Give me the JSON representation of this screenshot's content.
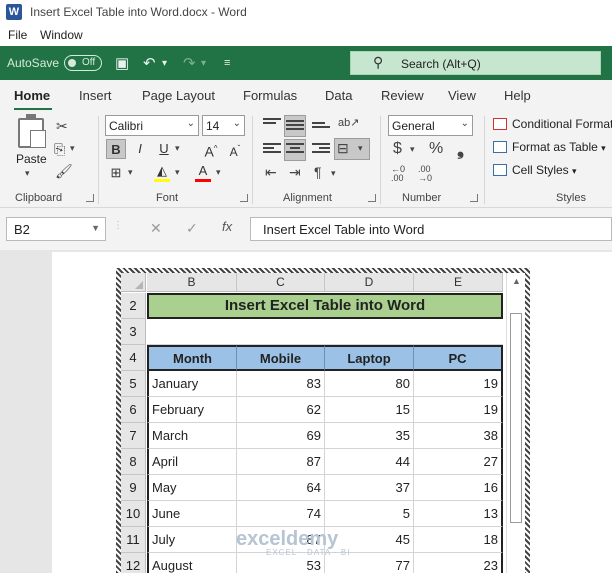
{
  "window": {
    "title": "Insert Excel Table into Word.docx - Word"
  },
  "menu": [
    "File",
    "Window"
  ],
  "qat": {
    "autosave_label": "AutoSave",
    "autosave_state": "Off",
    "search_label": "Search (Alt+Q)"
  },
  "ribbon": {
    "tabs": [
      "Home",
      "Insert",
      "Page Layout",
      "Formulas",
      "Data",
      "Review",
      "View",
      "Help"
    ],
    "active_tab": "Home",
    "clipboard": {
      "paste": "Paste",
      "label": "Clipboard"
    },
    "font": {
      "name": "Calibri",
      "size": "14",
      "label": "Font",
      "highlight_color": "#ffff00",
      "font_color": "#ff0000"
    },
    "alignment": {
      "label": "Alignment"
    },
    "number": {
      "format": "General",
      "label": "Number"
    },
    "styles": {
      "conditional": "Conditional Format",
      "format_table": "Format as Table",
      "cell_styles": "Cell Styles",
      "label": "Styles"
    }
  },
  "formula_bar": {
    "name_box": "B2",
    "fx": "fx",
    "content": "Insert Excel Table into Word"
  },
  "sheet": {
    "columns": [
      "B",
      "C",
      "D",
      "E"
    ],
    "rows": [
      "2",
      "3",
      "4",
      "5",
      "6",
      "7",
      "8",
      "9",
      "10",
      "11",
      "12"
    ],
    "title": "Insert Excel Table into Word",
    "headers": [
      "Month",
      "Mobile",
      "Laptop",
      "PC"
    ],
    "data": [
      [
        "January",
        "83",
        "80",
        "19"
      ],
      [
        "February",
        "62",
        "15",
        "19"
      ],
      [
        "March",
        "69",
        "35",
        "38"
      ],
      [
        "April",
        "87",
        "44",
        "27"
      ],
      [
        "May",
        "64",
        "37",
        "16"
      ],
      [
        "June",
        "74",
        "5",
        "13"
      ],
      [
        "July",
        "87",
        "45",
        "18"
      ],
      [
        "August",
        "53",
        "77",
        "23"
      ]
    ],
    "title_fill": "#a9d08e",
    "header_fill": "#9bc2e6"
  },
  "watermark": {
    "name": "exceldemy",
    "tagline": "EXCEL · DATA · BI"
  }
}
